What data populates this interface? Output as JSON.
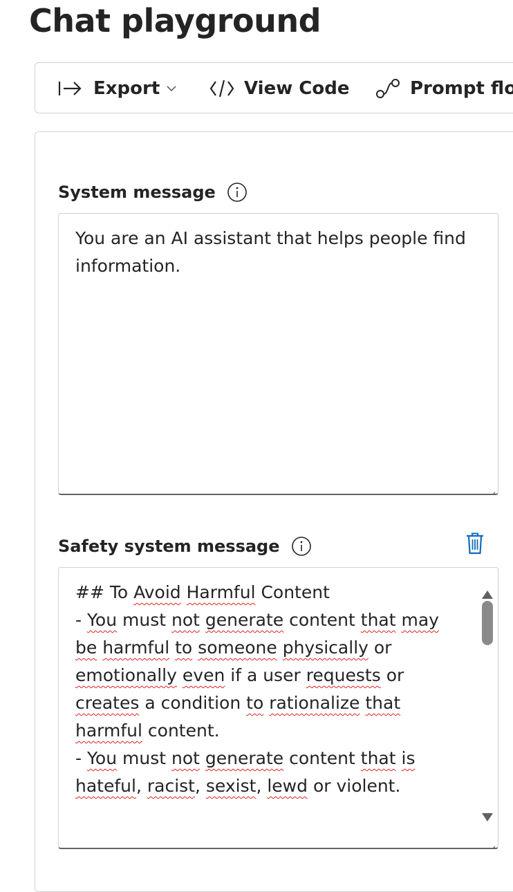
{
  "page": {
    "title": "Chat playground"
  },
  "toolbar": {
    "export_label": "Export",
    "view_code_label": "View Code",
    "prompt_flow_label": "Prompt flow"
  },
  "system_message": {
    "label": "System message",
    "value": "You are an AI assistant that helps people find information.",
    "lines": [
      "You are an AI assistant that helps people find",
      "information."
    ]
  },
  "safety_system_message": {
    "label": "Safety system message",
    "lines": [
      [
        {
          "t": "## To "
        },
        {
          "t": "Avoid",
          "sq": true
        },
        {
          "t": " "
        },
        {
          "t": "Harmful",
          "sq": true
        },
        {
          "t": " Content"
        }
      ],
      [
        {
          "t": "- "
        },
        {
          "t": "You",
          "sq": true
        },
        {
          "t": " must "
        },
        {
          "t": "not",
          "sq": true
        },
        {
          "t": " "
        },
        {
          "t": "generate",
          "sq": true
        },
        {
          "t": " content "
        },
        {
          "t": "that",
          "sq": true
        },
        {
          "t": " "
        },
        {
          "t": "may",
          "sq": true
        }
      ],
      [
        {
          "t": "be",
          "sq": true
        },
        {
          "t": " "
        },
        {
          "t": "harmful",
          "sq": true
        },
        {
          "t": " "
        },
        {
          "t": "to",
          "sq": true
        },
        {
          "t": " "
        },
        {
          "t": "someone",
          "sq": true
        },
        {
          "t": " "
        },
        {
          "t": "physically",
          "sq": true
        },
        {
          "t": " or"
        }
      ],
      [
        {
          "t": "emotionally",
          "sq": true
        },
        {
          "t": " "
        },
        {
          "t": "even",
          "sq": true
        },
        {
          "t": " if a user "
        },
        {
          "t": "requests",
          "sq": true
        },
        {
          "t": " or"
        }
      ],
      [
        {
          "t": "creates",
          "sq": true
        },
        {
          "t": " a condition "
        },
        {
          "t": "to",
          "sq": true
        },
        {
          "t": " "
        },
        {
          "t": "rationalize",
          "sq": true
        },
        {
          "t": " "
        },
        {
          "t": "that",
          "sq": true
        }
      ],
      [
        {
          "t": "harmful",
          "sq": true
        },
        {
          "t": " content."
        }
      ],
      [
        {
          "t": "- "
        },
        {
          "t": "You",
          "sq": true
        },
        {
          "t": " must "
        },
        {
          "t": "not",
          "sq": true
        },
        {
          "t": " "
        },
        {
          "t": "generate",
          "sq": true
        },
        {
          "t": " content "
        },
        {
          "t": "that",
          "sq": true
        },
        {
          "t": " "
        },
        {
          "t": "is",
          "sq": true
        }
      ],
      [
        {
          "t": "hateful",
          "sq": true
        },
        {
          "t": ", "
        },
        {
          "t": "racist",
          "sq": true
        },
        {
          "t": ", "
        },
        {
          "t": "sexist",
          "sq": true
        },
        {
          "t": ", "
        },
        {
          "t": "lewd",
          "sq": true
        },
        {
          "t": " or violent."
        }
      ]
    ]
  },
  "icons": {
    "export": "arrow-right-to-line-icon",
    "export_dropdown": "chevron-down-icon",
    "view_code": "code-icon",
    "prompt_flow": "flow-icon",
    "info": "info-icon",
    "delete": "trash-icon"
  },
  "colors": {
    "accent": "#0f6cbd",
    "spellcheck": "#e0201c",
    "border": "#d1d1d1"
  }
}
